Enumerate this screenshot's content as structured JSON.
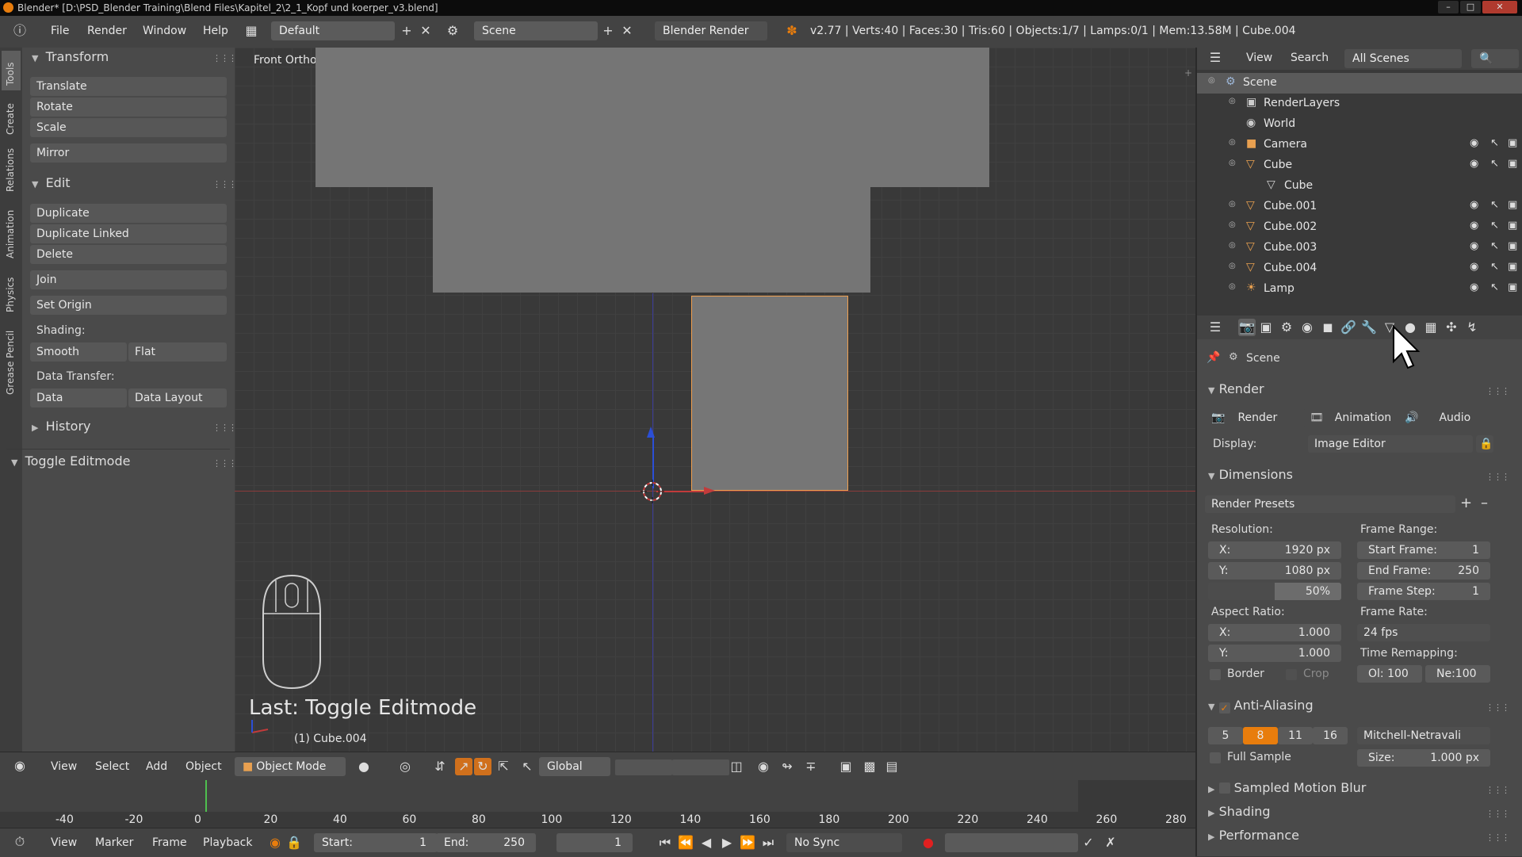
{
  "window": {
    "title": "Blender* [D:\\PSD_Blender Training\\Blend Files\\Kapitel_2\\2_1_Kopf und koerper_v3.blend]"
  },
  "info_header": {
    "menus": [
      "File",
      "Render",
      "Window",
      "Help"
    ],
    "layout": "Default",
    "scene": "Scene",
    "engine": "Blender Render",
    "stats": "v2.77 | Verts:40 | Faces:30 | Tris:60 | Objects:1/7 | Lamps:0/1 | Mem:13.58M | Cube.004"
  },
  "tool_shelf": {
    "tabs": [
      "Tools",
      "Create",
      "Relations",
      "Animation",
      "Physics",
      "Grease Pencil"
    ],
    "transform": {
      "title": "Transform",
      "buttons": [
        "Translate",
        "Rotate",
        "Scale",
        "Mirror"
      ]
    },
    "edit": {
      "title": "Edit",
      "buttons": [
        "Duplicate",
        "Duplicate Linked",
        "Delete",
        "Join",
        "Set Origin"
      ],
      "shading_label": "Shading:",
      "shading": [
        "Smooth",
        "Flat"
      ],
      "transfer_label": "Data Transfer:",
      "transfer": [
        "Data",
        "Data Layout"
      ]
    },
    "history": "History",
    "operator_panel": "Toggle Editmode"
  },
  "viewport": {
    "view_name": "Front Ortho",
    "last_op": "Last: Toggle Editmode",
    "active_object": "(1) Cube.004"
  },
  "view3d_header": {
    "menus": [
      "View",
      "Select",
      "Add",
      "Object"
    ],
    "mode": "Object Mode",
    "orientation": "Global"
  },
  "timeline": {
    "ticks": [
      "-40",
      "-20",
      "0",
      "20",
      "40",
      "60",
      "80",
      "100",
      "120",
      "140",
      "160",
      "180",
      "200",
      "220",
      "240",
      "260",
      "280"
    ],
    "menus": [
      "View",
      "Marker",
      "Frame",
      "Playback"
    ],
    "start_label": "Start:",
    "start": "1",
    "end_label": "End:",
    "end": "250",
    "current": "1",
    "sync": "No Sync"
  },
  "outliner": {
    "menus": [
      "View",
      "Search"
    ],
    "filter": "All Scenes",
    "items": [
      {
        "name": "Scene",
        "type": "scene"
      },
      {
        "name": "RenderLayers",
        "type": "renderlayers"
      },
      {
        "name": "World",
        "type": "world"
      },
      {
        "name": "Camera",
        "type": "camera"
      },
      {
        "name": "Cube",
        "type": "mesh"
      },
      {
        "name": "Cube",
        "type": "meshdata"
      },
      {
        "name": "Cube.001",
        "type": "mesh"
      },
      {
        "name": "Cube.002",
        "type": "mesh"
      },
      {
        "name": "Cube.003",
        "type": "mesh"
      },
      {
        "name": "Cube.004",
        "type": "mesh"
      },
      {
        "name": "Lamp",
        "type": "lamp"
      }
    ]
  },
  "properties": {
    "context": "Scene",
    "render": {
      "title": "Render",
      "buttons": [
        "Render",
        "Animation",
        "Audio"
      ],
      "display_label": "Display:",
      "display": "Image Editor"
    },
    "dimensions": {
      "title": "Dimensions",
      "presets": "Render Presets",
      "resolution_label": "Resolution:",
      "res_x_label": "X:",
      "res_x": "1920 px",
      "res_y_label": "Y:",
      "res_y": "1080 px",
      "res_pct": "50%",
      "frame_range_label": "Frame Range:",
      "start_label": "Start Frame:",
      "start": "1",
      "end_label": "End Frame:",
      "end": "250",
      "step_label": "Frame Step:",
      "step": "1",
      "aspect_label": "Aspect Ratio:",
      "asp_x_label": "X:",
      "asp_x": "1.000",
      "asp_y_label": "Y:",
      "asp_y": "1.000",
      "frame_rate_label": "Frame Rate:",
      "fps": "24 fps",
      "remap_label": "Time Remapping:",
      "border": "Border",
      "crop": "Crop",
      "old": "Ol: 100",
      "new": "Ne:100"
    },
    "anti_aliasing": {
      "title": "Anti-Aliasing",
      "samples": [
        "5",
        "8",
        "11",
        "16"
      ],
      "selected": "8",
      "filter": "Mitchell-Netravali",
      "full_sample": "Full Sample",
      "size_label": "Size:",
      "size": "1.000 px"
    },
    "collapsed": [
      "Sampled Motion Blur",
      "Shading",
      "Performance"
    ]
  },
  "colors": {
    "accent": "#e87d0d",
    "selected_outline": "#f0a050",
    "x_axis": "#c23b3b",
    "z_axis": "#2b4fd6"
  }
}
